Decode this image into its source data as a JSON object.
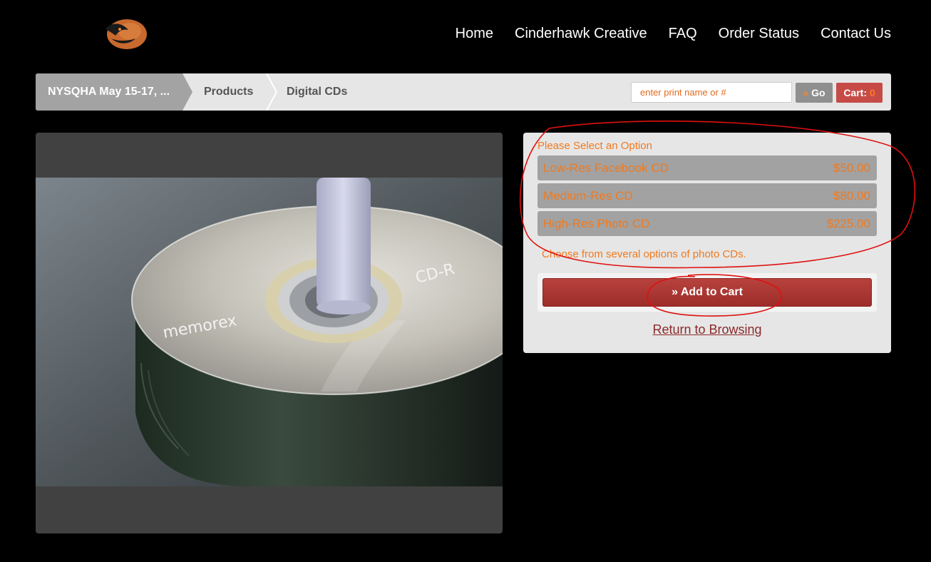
{
  "header": {
    "logo_icon": "hawk-logo-icon",
    "nav": [
      "Home",
      "Cinderhawk Creative",
      "FAQ",
      "Order Status",
      "Contact Us"
    ]
  },
  "breadcrumb": {
    "items": [
      "NYSQHA May 15-17, ...",
      "Products",
      "Digital CDs"
    ]
  },
  "search": {
    "placeholder": "enter print name or #",
    "go_prefix": "»",
    "go_label": "Go"
  },
  "cart": {
    "label": "Cart:",
    "count": "0"
  },
  "product": {
    "image_icon": "cd-stack-photo",
    "disc_brand": "memorex",
    "disc_label": "CD-R"
  },
  "options": {
    "title": "Please Select an Option",
    "items": [
      {
        "label": "Low-Res Facebook CD",
        "price": "$50.00"
      },
      {
        "label": "Medium-Res CD",
        "price": "$80.00"
      },
      {
        "label": "High-Res Photo CD",
        "price": "$225.00"
      }
    ],
    "description": "Choose from several options of photo CDs."
  },
  "actions": {
    "add_to_cart": "» Add to Cart",
    "return": "Return to Browsing"
  },
  "colors": {
    "accent_orange": "#f07a1f",
    "cart_red": "#c64b47",
    "button_red": "#a83431",
    "annotation_red": "#e01010"
  }
}
